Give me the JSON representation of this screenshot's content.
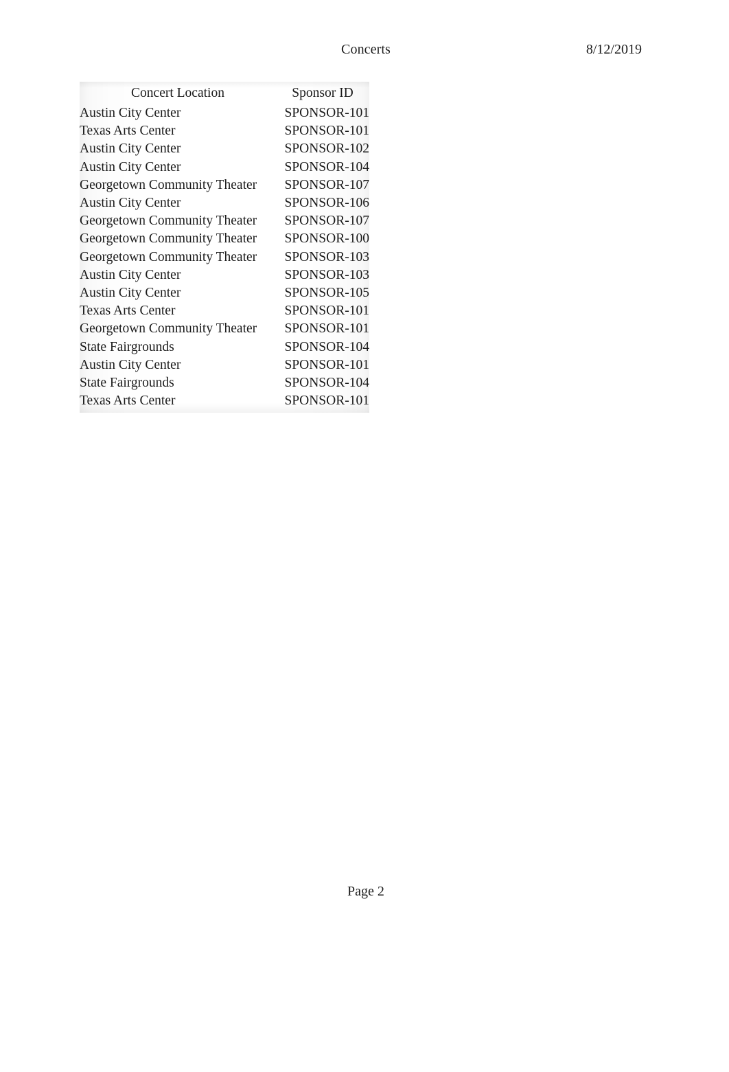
{
  "document": {
    "header": {
      "title": "Concerts",
      "date": "8/12/2019"
    },
    "footer": {
      "page_label": "Page 2"
    }
  },
  "table": {
    "columns": [
      {
        "key": "location",
        "header": "Concert Location",
        "align": "left"
      },
      {
        "key": "sponsor",
        "header": "Sponsor ID",
        "align": "right"
      }
    ],
    "rows": [
      {
        "location": "Austin City Center",
        "sponsor": "SPONSOR-101"
      },
      {
        "location": "Texas Arts Center",
        "sponsor": "SPONSOR-101"
      },
      {
        "location": "Austin City Center",
        "sponsor": "SPONSOR-102"
      },
      {
        "location": "Austin City Center",
        "sponsor": "SPONSOR-104"
      },
      {
        "location": "Georgetown Community Theater",
        "sponsor": "SPONSOR-107"
      },
      {
        "location": "Austin City Center",
        "sponsor": "SPONSOR-106"
      },
      {
        "location": "Georgetown Community Theater",
        "sponsor": "SPONSOR-107"
      },
      {
        "location": "Georgetown Community Theater",
        "sponsor": "SPONSOR-100"
      },
      {
        "location": "Georgetown Community Theater",
        "sponsor": "SPONSOR-103"
      },
      {
        "location": "Austin City Center",
        "sponsor": "SPONSOR-103"
      },
      {
        "location": "Austin City Center",
        "sponsor": "SPONSOR-105"
      },
      {
        "location": "Texas Arts Center",
        "sponsor": "SPONSOR-101"
      },
      {
        "location": "Georgetown Community Theater",
        "sponsor": "SPONSOR-101"
      },
      {
        "location": "State Fairgrounds",
        "sponsor": "SPONSOR-104"
      },
      {
        "location": "Austin City Center",
        "sponsor": "SPONSOR-101"
      },
      {
        "location": "State Fairgrounds",
        "sponsor": "SPONSOR-104"
      },
      {
        "location": "Texas Arts Center",
        "sponsor": "SPONSOR-101"
      }
    ]
  }
}
